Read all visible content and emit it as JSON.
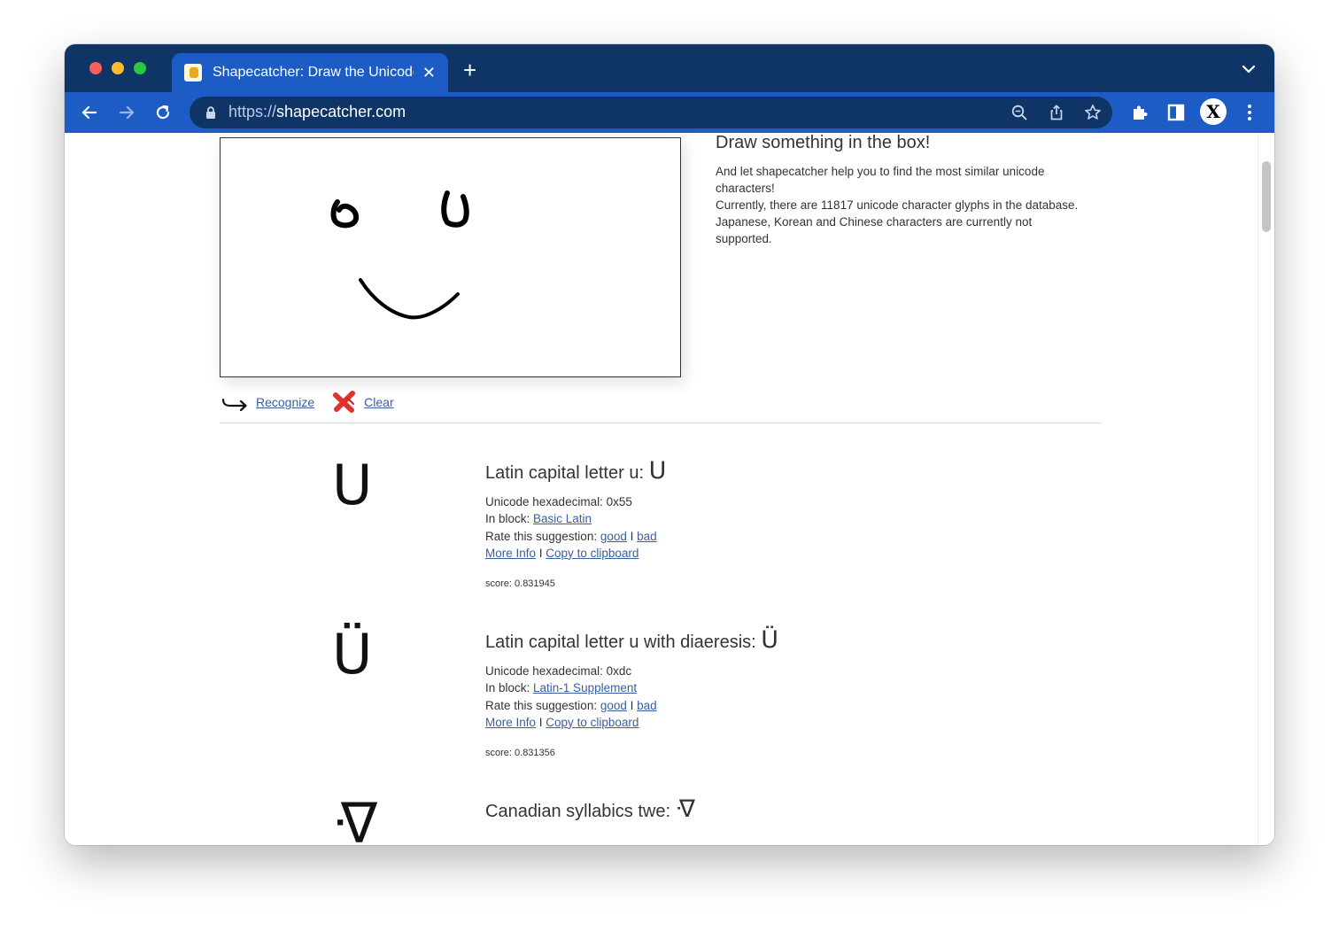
{
  "browser": {
    "tab_title": "Shapecatcher: Draw the Unicode characters",
    "tab_close": "✕",
    "new_tab": "+",
    "url_scheme": "https://",
    "url_host": "shapecatcher.com",
    "profile_initial": "X"
  },
  "intro": {
    "title": "Draw something in the box!",
    "line1": "And let shapecatcher help you to find the most similar unicode characters!",
    "line2": "Currently, there are 11817 unicode character glyphs in the database.",
    "line3": "Japanese, Korean and Chinese characters are currently not supported."
  },
  "actions": {
    "recognize": "Recognize",
    "clear": "Clear"
  },
  "labels": {
    "hex_prefix": "Unicode hexadecimal: ",
    "block_prefix": "In block: ",
    "rate_prefix": "Rate this suggestion: ",
    "good": "good",
    "bad": "bad",
    "separator": " I ",
    "more_info": "More Info",
    "copy": "Copy to clipboard",
    "score_prefix": "score: "
  },
  "results": [
    {
      "glyph": "U",
      "name": "Latin capital letter u: ",
      "hex": "0x55",
      "block": "Basic Latin",
      "score": "0.831945"
    },
    {
      "glyph": "Ü",
      "name": "Latin capital letter u with diaeresis: ",
      "hex": "0xdc",
      "block": "Latin-1 Supplement",
      "score": "0.831356"
    },
    {
      "glyph": "ᐌ",
      "name": "Canadian syllabics twe: ",
      "hex": "",
      "block": "",
      "score": ""
    }
  ]
}
